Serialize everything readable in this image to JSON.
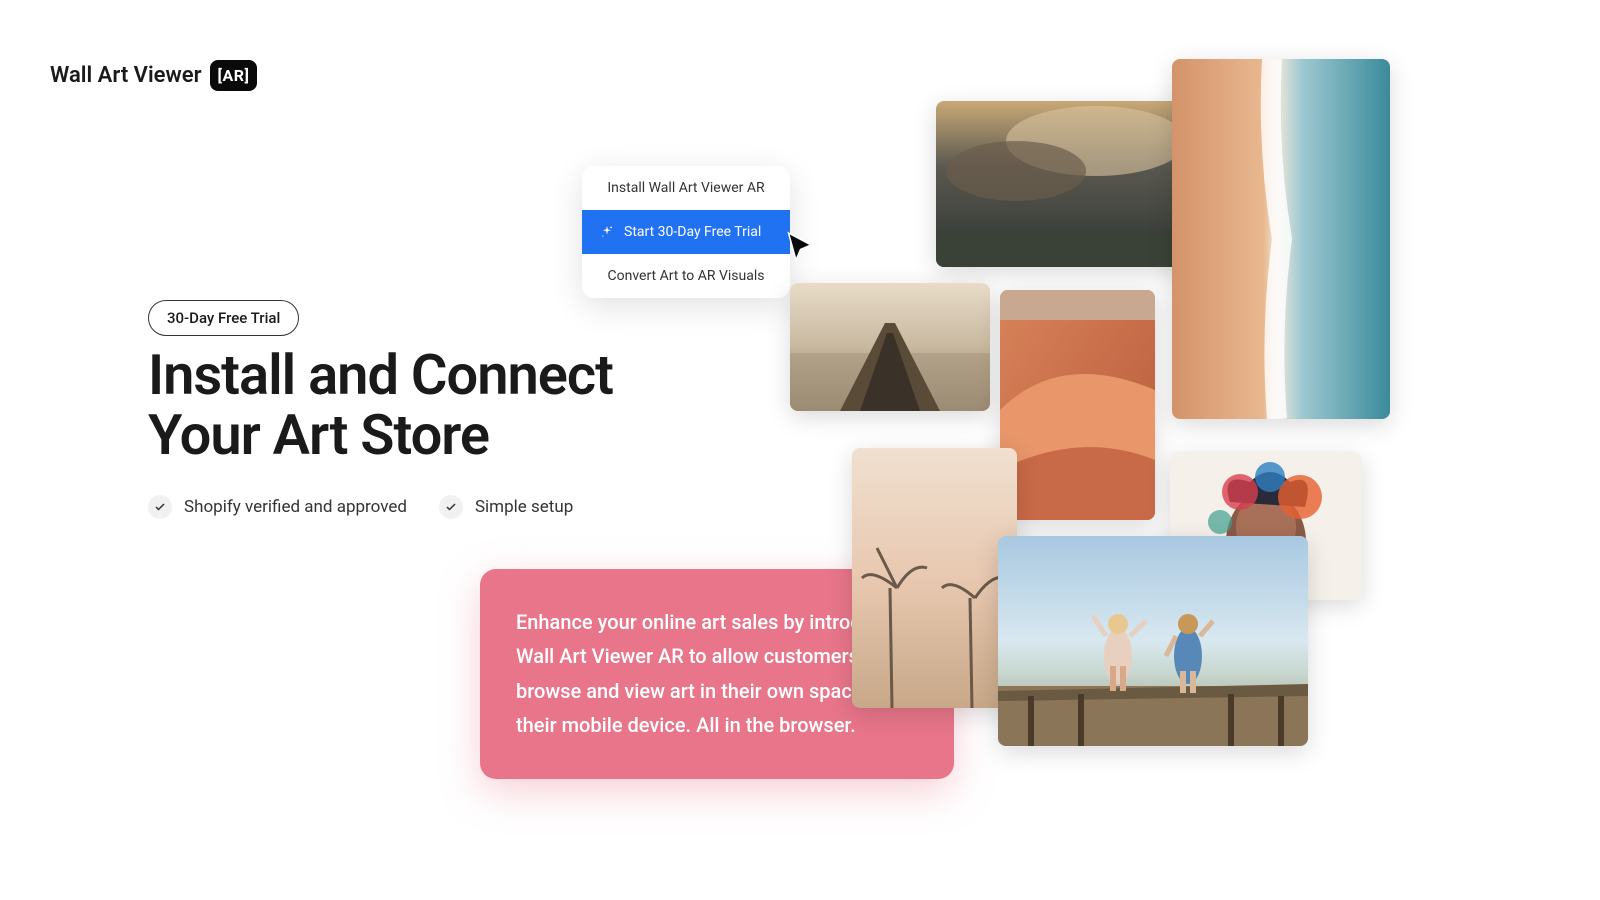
{
  "logo": {
    "text": "Wall Art Viewer",
    "badge": "[AR]"
  },
  "badge": "30-Day Free Trial",
  "headline": "Install and Connect\nYour Art Store",
  "features": [
    {
      "text": "Shopify verified and approved"
    },
    {
      "text": "Simple setup"
    }
  ],
  "dropdown": {
    "items": [
      {
        "label": "Install Wall Art Viewer AR",
        "active": false
      },
      {
        "label": "Start 30-Day Free Trial",
        "active": true
      },
      {
        "label": "Convert Art to AR Visuals",
        "active": false
      }
    ]
  },
  "callout": "Enhance your online art sales by introducing Wall Art Viewer AR to allow customers to browse and view art in their own space using their mobile device. All in the browser.",
  "gallery_count": 7
}
